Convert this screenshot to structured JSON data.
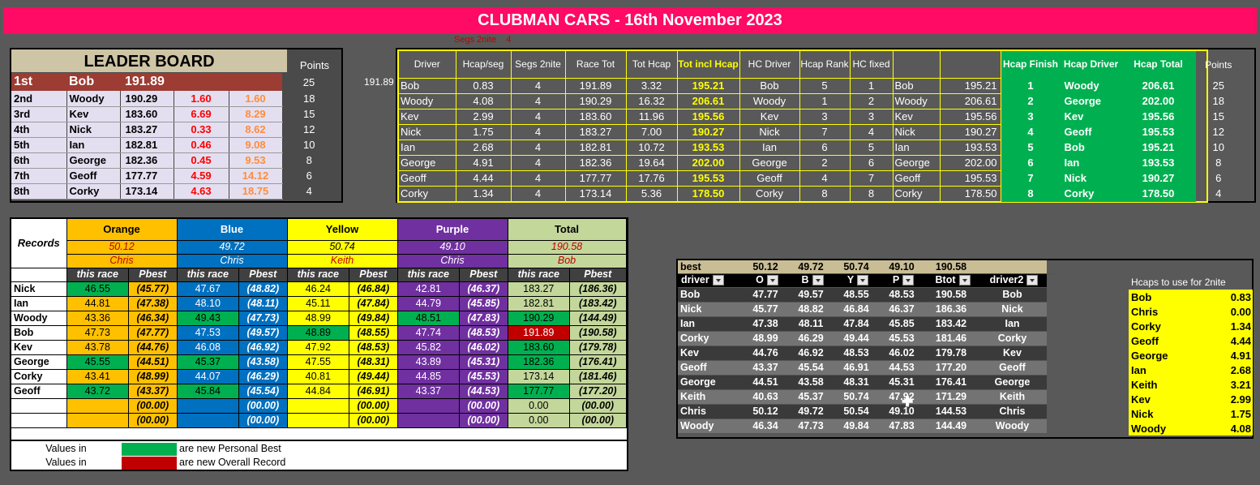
{
  "title": "CLUBMAN CARS - 16th November 2023",
  "segs_label": "Segs 2nite",
  "segs_value": "4",
  "leader_board": {
    "heading": "LEADER BOARD",
    "points_label": "Points",
    "rows": [
      {
        "pos": "1st",
        "name": "Bob",
        "total": "191.89",
        "gap": "",
        "cum": "",
        "points": "25"
      },
      {
        "pos": "2nd",
        "name": "Woody",
        "total": "190.29",
        "gap": "1.60",
        "cum": "1.60",
        "points": "18"
      },
      {
        "pos": "3rd",
        "name": "Kev",
        "total": "183.60",
        "gap": "6.69",
        "cum": "8.29",
        "points": "15"
      },
      {
        "pos": "4th",
        "name": "Nick",
        "total": "183.27",
        "gap": "0.33",
        "cum": "8.62",
        "points": "12"
      },
      {
        "pos": "5th",
        "name": "Ian",
        "total": "182.81",
        "gap": "0.46",
        "cum": "9.08",
        "points": "10"
      },
      {
        "pos": "6th",
        "name": "George",
        "total": "182.36",
        "gap": "0.45",
        "cum": "9.53",
        "points": "8"
      },
      {
        "pos": "7th",
        "name": "Geoff",
        "total": "177.77",
        "gap": "4.59",
        "cum": "14.12",
        "points": "6"
      },
      {
        "pos": "8th",
        "name": "Corky",
        "total": "173.14",
        "gap": "4.63",
        "cum": "18.75",
        "points": "4"
      }
    ]
  },
  "lone_value": "191.89",
  "hcap_table": {
    "headers": [
      "Driver",
      "Hcap/seg",
      "Segs 2nite",
      "Race Tot",
      "Tot Hcap",
      "Tot incl Hcap",
      "HC Driver",
      "Hcap Rank",
      "HC fixed",
      "",
      "",
      "Hcap Finish",
      "Hcap Driver",
      "Hcap Total",
      "Points"
    ],
    "rows": [
      [
        "Bob",
        "0.83",
        "4",
        "191.89",
        "3.32",
        "195.21",
        "Bob",
        "5",
        "1",
        "Bob",
        "195.21",
        "1",
        "Woody",
        "206.61",
        "25"
      ],
      [
        "Woody",
        "4.08",
        "4",
        "190.29",
        "16.32",
        "206.61",
        "Woody",
        "1",
        "2",
        "Woody",
        "206.61",
        "2",
        "George",
        "202.00",
        "18"
      ],
      [
        "Kev",
        "2.99",
        "4",
        "183.60",
        "11.96",
        "195.56",
        "Kev",
        "3",
        "3",
        "Kev",
        "195.56",
        "3",
        "Kev",
        "195.56",
        "15"
      ],
      [
        "Nick",
        "1.75",
        "4",
        "183.27",
        "7.00",
        "190.27",
        "Nick",
        "7",
        "4",
        "Nick",
        "190.27",
        "4",
        "Geoff",
        "195.53",
        "12"
      ],
      [
        "Ian",
        "2.68",
        "4",
        "182.81",
        "10.72",
        "193.53",
        "Ian",
        "6",
        "5",
        "Ian",
        "193.53",
        "5",
        "Bob",
        "195.21",
        "10"
      ],
      [
        "George",
        "4.91",
        "4",
        "182.36",
        "19.64",
        "202.00",
        "George",
        "2",
        "6",
        "George",
        "202.00",
        "6",
        "Ian",
        "193.53",
        "8"
      ],
      [
        "Geoff",
        "4.44",
        "4",
        "177.77",
        "17.76",
        "195.53",
        "Geoff",
        "4",
        "7",
        "Geoff",
        "195.53",
        "7",
        "Nick",
        "190.27",
        "6"
      ],
      [
        "Corky",
        "1.34",
        "4",
        "173.14",
        "5.36",
        "178.50",
        "Corky",
        "8",
        "8",
        "Corky",
        "178.50",
        "8",
        "Corky",
        "178.50",
        "4"
      ]
    ]
  },
  "records": {
    "label": "Records",
    "columns": [
      "Orange",
      "Blue",
      "Yellow",
      "Purple",
      "Total"
    ],
    "record_values": [
      "50.12",
      "49.72",
      "50.74",
      "49.10",
      "190.58"
    ],
    "record_holders": [
      "Chris",
      "Chris",
      "Keith",
      "Chris",
      "Bob"
    ],
    "sub_headers": [
      "this race",
      "Pbest"
    ],
    "rows": [
      {
        "name": "Nick",
        "v": [
          "46.55",
          "(45.77)",
          "47.67",
          "(48.82)",
          "46.24",
          "(46.84)",
          "42.81",
          "(46.37)",
          "183.27",
          "(186.36)"
        ],
        "hl": [
          "g",
          "",
          "",
          "",
          "",
          "",
          "",
          "",
          "",
          ""
        ]
      },
      {
        "name": "Ian",
        "v": [
          "44.81",
          "(47.38)",
          "48.10",
          "(48.11)",
          "45.11",
          "(47.84)",
          "44.79",
          "(45.85)",
          "182.81",
          "(183.42)"
        ],
        "hl": [
          "",
          "",
          "",
          "",
          "",
          "",
          "",
          "",
          "",
          ""
        ]
      },
      {
        "name": "Woody",
        "v": [
          "43.36",
          "(46.34)",
          "49.43",
          "(47.73)",
          "48.99",
          "(49.84)",
          "48.51",
          "(47.83)",
          "190.29",
          "(144.49)"
        ],
        "hl": [
          "",
          "",
          "g",
          "",
          "",
          "",
          "g",
          "",
          "g",
          ""
        ]
      },
      {
        "name": "Bob",
        "v": [
          "47.73",
          "(47.77)",
          "47.53",
          "(49.57)",
          "48.89",
          "(48.55)",
          "47.74",
          "(48.53)",
          "191.89",
          "(190.58)"
        ],
        "hl": [
          "",
          "",
          "",
          "",
          "g",
          "",
          "",
          "",
          "r",
          ""
        ]
      },
      {
        "name": "Kev",
        "v": [
          "43.78",
          "(44.76)",
          "46.08",
          "(46.92)",
          "47.92",
          "(48.53)",
          "45.82",
          "(46.02)",
          "183.60",
          "(179.78)"
        ],
        "hl": [
          "",
          "",
          "",
          "",
          "",
          "",
          "",
          "",
          "g",
          ""
        ]
      },
      {
        "name": "George",
        "v": [
          "45.55",
          "(44.51)",
          "45.37",
          "(43.58)",
          "47.55",
          "(48.31)",
          "43.89",
          "(45.31)",
          "182.36",
          "(176.41)"
        ],
        "hl": [
          "g",
          "",
          "g",
          "",
          "",
          "",
          "",
          "",
          "g",
          ""
        ]
      },
      {
        "name": "Corky",
        "v": [
          "43.41",
          "(48.99)",
          "44.07",
          "(46.29)",
          "40.81",
          "(49.44)",
          "44.85",
          "(45.53)",
          "173.14",
          "(181.46)"
        ],
        "hl": [
          "",
          "",
          "",
          "",
          "",
          "",
          "",
          "",
          "",
          ""
        ]
      },
      {
        "name": "Geoff",
        "v": [
          "43.72",
          "(43.37)",
          "45.84",
          "(45.54)",
          "44.84",
          "(46.91)",
          "43.37",
          "(44.53)",
          "177.77",
          "(177.20)"
        ],
        "hl": [
          "g",
          "",
          "g",
          "",
          "",
          "",
          "",
          "",
          "g",
          ""
        ]
      },
      {
        "name": "",
        "v": [
          "",
          "(00.00)",
          "",
          "(00.00)",
          "",
          "(00.00)",
          "",
          "(00.00)",
          "0.00",
          "(00.00)"
        ],
        "hl": [
          "",
          "",
          "",
          "",
          "",
          "",
          "",
          "",
          "",
          ""
        ]
      },
      {
        "name": "",
        "v": [
          "",
          "(00.00)",
          "",
          "(00.00)",
          "",
          "(00.00)",
          "",
          "(00.00)",
          "0.00",
          "(00.00)"
        ],
        "hl": [
          "",
          "",
          "",
          "",
          "",
          "",
          "",
          "",
          "",
          ""
        ]
      }
    ],
    "legend": [
      {
        "prefix": "Values in",
        "color": "#00b050",
        "text": "are new Personal Best"
      },
      {
        "prefix": "Values in",
        "color": "#c00000",
        "text": "are new Overall Record"
      }
    ]
  },
  "best_table": {
    "best_label": "best",
    "best_values": [
      "50.12",
      "49.72",
      "50.74",
      "49.10",
      "190.58"
    ],
    "headers": [
      "driver",
      "O",
      "B",
      "Y",
      "P",
      "Btot",
      "driver2"
    ],
    "rows": [
      [
        "Bob",
        "47.77",
        "49.57",
        "48.55",
        "48.53",
        "190.58",
        "Bob"
      ],
      [
        "Nick",
        "45.77",
        "48.82",
        "46.84",
        "46.37",
        "186.36",
        "Nick"
      ],
      [
        "Ian",
        "47.38",
        "48.11",
        "47.84",
        "45.85",
        "183.42",
        "Ian"
      ],
      [
        "Corky",
        "48.99",
        "46.29",
        "49.44",
        "45.53",
        "181.46",
        "Corky"
      ],
      [
        "Kev",
        "44.76",
        "46.92",
        "48.53",
        "46.02",
        "179.78",
        "Kev"
      ],
      [
        "Geoff",
        "43.37",
        "45.54",
        "46.91",
        "44.53",
        "177.20",
        "Geoff"
      ],
      [
        "George",
        "44.51",
        "43.58",
        "48.31",
        "45.31",
        "176.41",
        "George"
      ],
      [
        "Keith",
        "40.63",
        "45.37",
        "50.74",
        "47.92",
        "171.29",
        "Keith"
      ],
      [
        "Chris",
        "50.12",
        "49.72",
        "50.54",
        "49.10",
        "144.53",
        "Chris"
      ],
      [
        "Woody",
        "46.34",
        "47.73",
        "49.84",
        "47.83",
        "144.49",
        "Woody"
      ]
    ]
  },
  "hcaps": {
    "title": "Hcaps to use for 2nite",
    "rows": [
      [
        "Bob",
        "0.83"
      ],
      [
        "Chris",
        "0.00"
      ],
      [
        "Corky",
        "1.34"
      ],
      [
        "Geoff",
        "4.44"
      ],
      [
        "George",
        "4.91"
      ],
      [
        "Ian",
        "2.68"
      ],
      [
        "Keith",
        "3.21"
      ],
      [
        "Kev",
        "2.99"
      ],
      [
        "Nick",
        "1.75"
      ],
      [
        "Woody",
        "4.08"
      ]
    ]
  },
  "colors": {
    "title_bar": "#ff0a64",
    "background": "#595959",
    "highlight_green": "#00b050",
    "highlight_red": "#c00000",
    "yellow": "#ffff00"
  }
}
